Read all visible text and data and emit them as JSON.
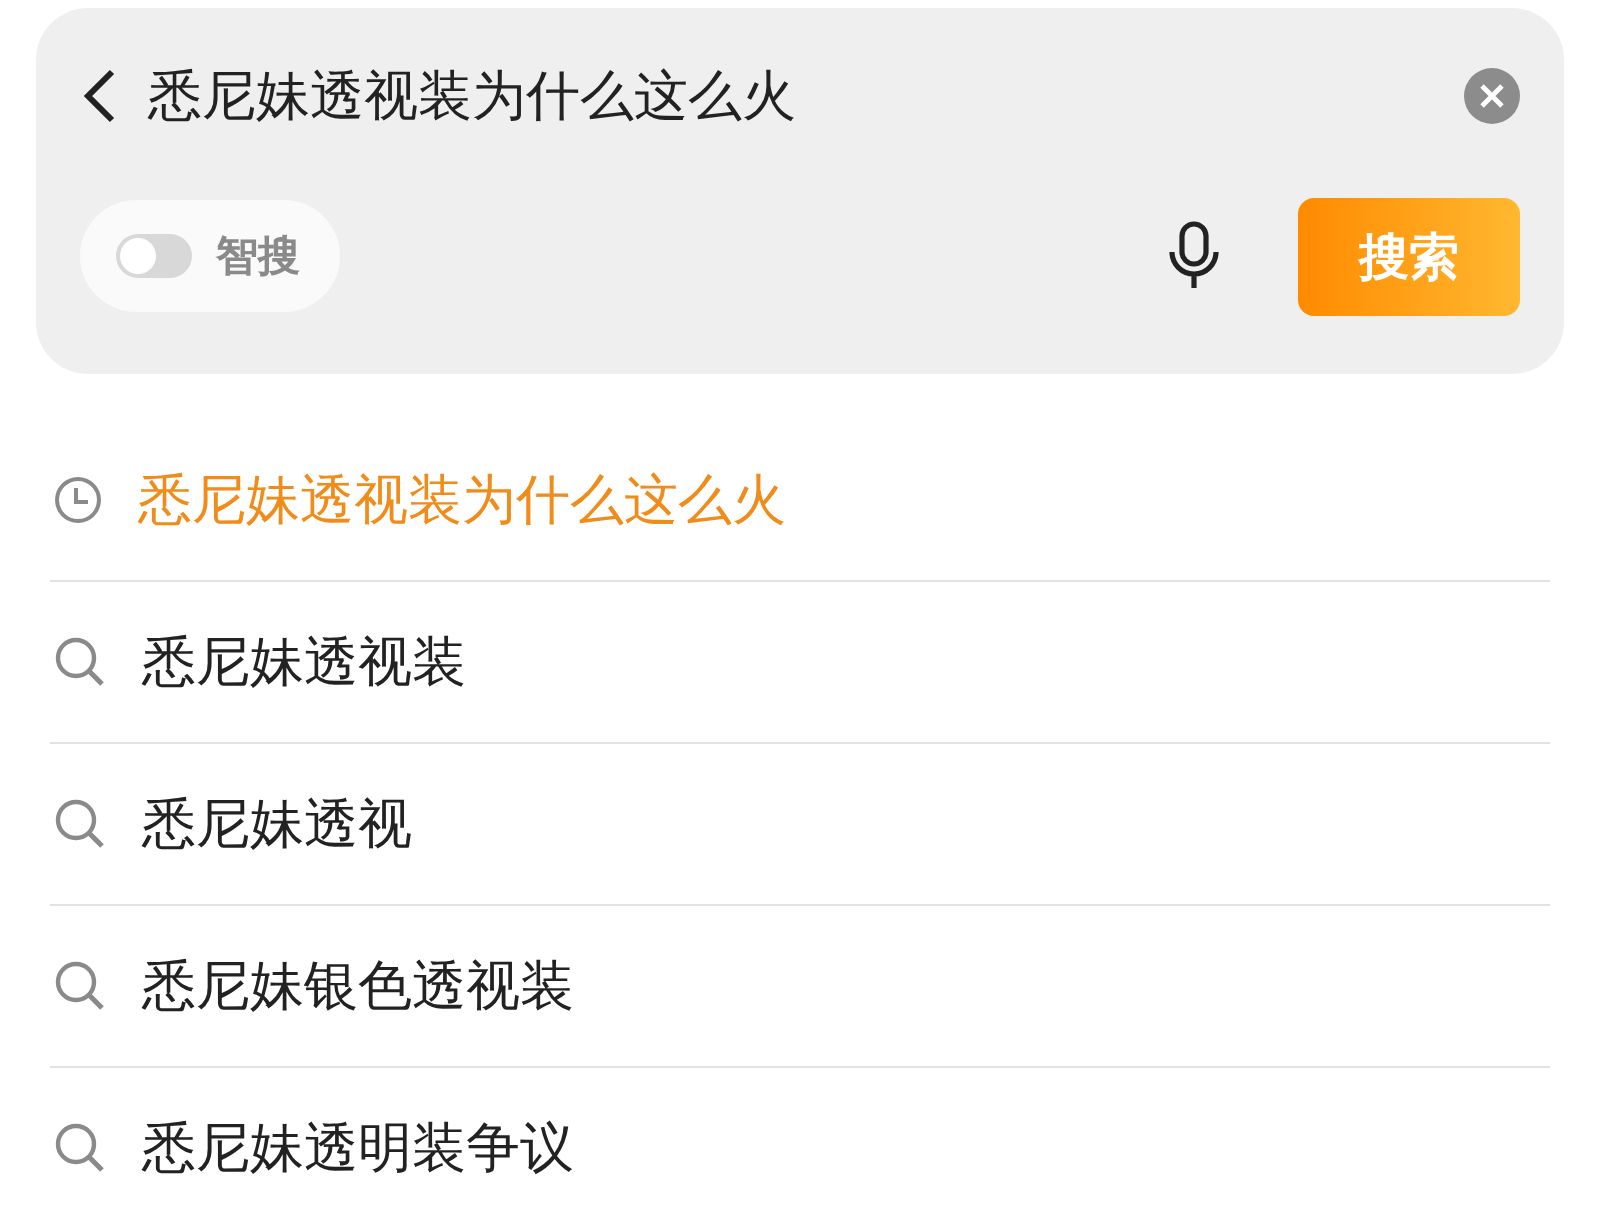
{
  "search_bar": {
    "query": "悉尼妹透视装为什么这么火",
    "smart_search": {
      "label": "智搜",
      "on": false
    },
    "search_button": "搜索"
  },
  "suggestions": [
    {
      "kind": "history",
      "text": "悉尼妹透视装为什么这么火"
    },
    {
      "kind": "suggestion",
      "text": "悉尼妹透视装"
    },
    {
      "kind": "suggestion",
      "text": "悉尼妹透视"
    },
    {
      "kind": "suggestion",
      "text": "悉尼妹银色透视装"
    },
    {
      "kind": "suggestion",
      "text": "悉尼妹透明装争议"
    }
  ]
}
